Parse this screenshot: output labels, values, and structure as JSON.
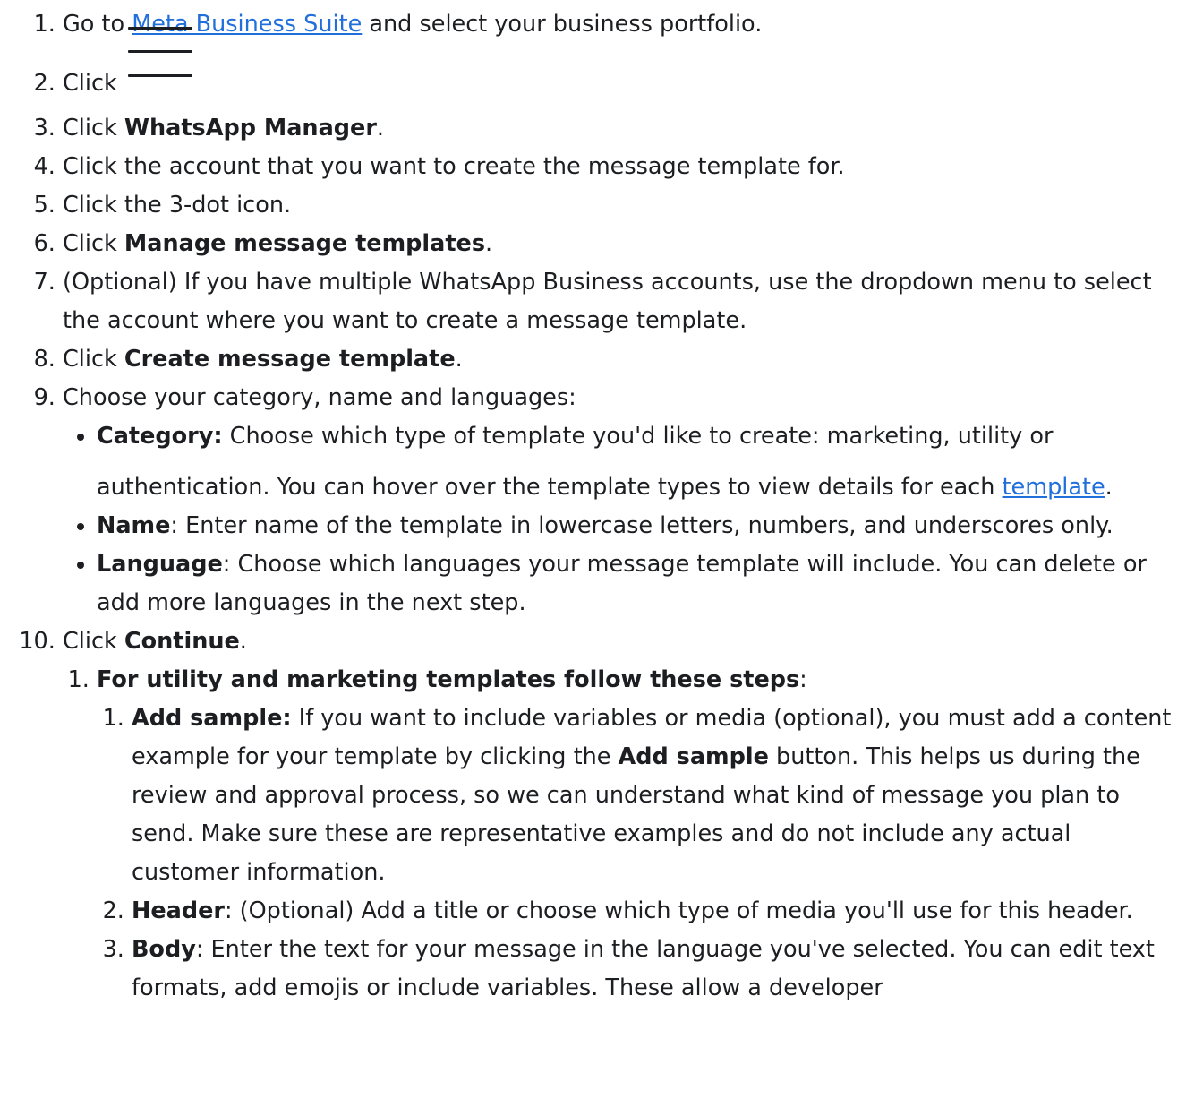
{
  "steps": {
    "s1": {
      "before": "Go to ",
      "link": "Meta Business Suite",
      "after": " and select your business portfolio."
    },
    "s2": {
      "text": "Click "
    },
    "s3": {
      "before": "Click ",
      "bold": "WhatsApp Manager",
      "after": "."
    },
    "s4": {
      "text": "Click the account that you want to create the message template for."
    },
    "s5": {
      "text": "Click the 3-dot icon."
    },
    "s6": {
      "before": "Click ",
      "bold": "Manage message templates",
      "after": "."
    },
    "s7": {
      "text": "(Optional) If you have multiple WhatsApp Business accounts, use the dropdown menu to select the account where you want to create a message template."
    },
    "s8": {
      "before": "Click ",
      "bold": "Create message template",
      "after": "."
    },
    "s9": {
      "text": "Choose your category, name and languages:",
      "category": {
        "bold": "Category:",
        "text": " Choose which type of template you'd like to create: marketing, utility or authentication. You can hover over the template types to view details for each ",
        "link": "template",
        "after": "."
      },
      "name": {
        "bold": "Name",
        "text": ": Enter name of the template in lowercase letters, numbers, and underscores only."
      },
      "language": {
        "bold": "Language",
        "text": ": Choose which languages your message template will include. You can delete or add more languages in the next step."
      }
    },
    "s10": {
      "before": "Click ",
      "bold": "Continue",
      "after": ".",
      "utility": {
        "bold": "For utility and marketing templates follow these steps",
        "after": ":",
        "sample": {
          "bold": "Add sample:",
          "text1": " If you want to include variables or media (optional), you must add a content example for your template by clicking the ",
          "bold2": "Add sample",
          "text2": " button. This helps us during the review and approval process, so we can understand what kind of message you plan to send. Make sure these are representative examples and do not include any actual customer information."
        },
        "header": {
          "bold": "Header",
          "text": ": (Optional) Add a title or choose which type of media you'll use for this header."
        },
        "body": {
          "bold": "Body",
          "text": ": Enter the text for your message in the language you've selected. You can edit text formats, add emojis or include variables. These allow a developer"
        }
      }
    }
  },
  "icons": {
    "menu": "hamburger-menu-icon"
  },
  "colors": {
    "link": "#216fdb",
    "text": "#1c1e21"
  }
}
